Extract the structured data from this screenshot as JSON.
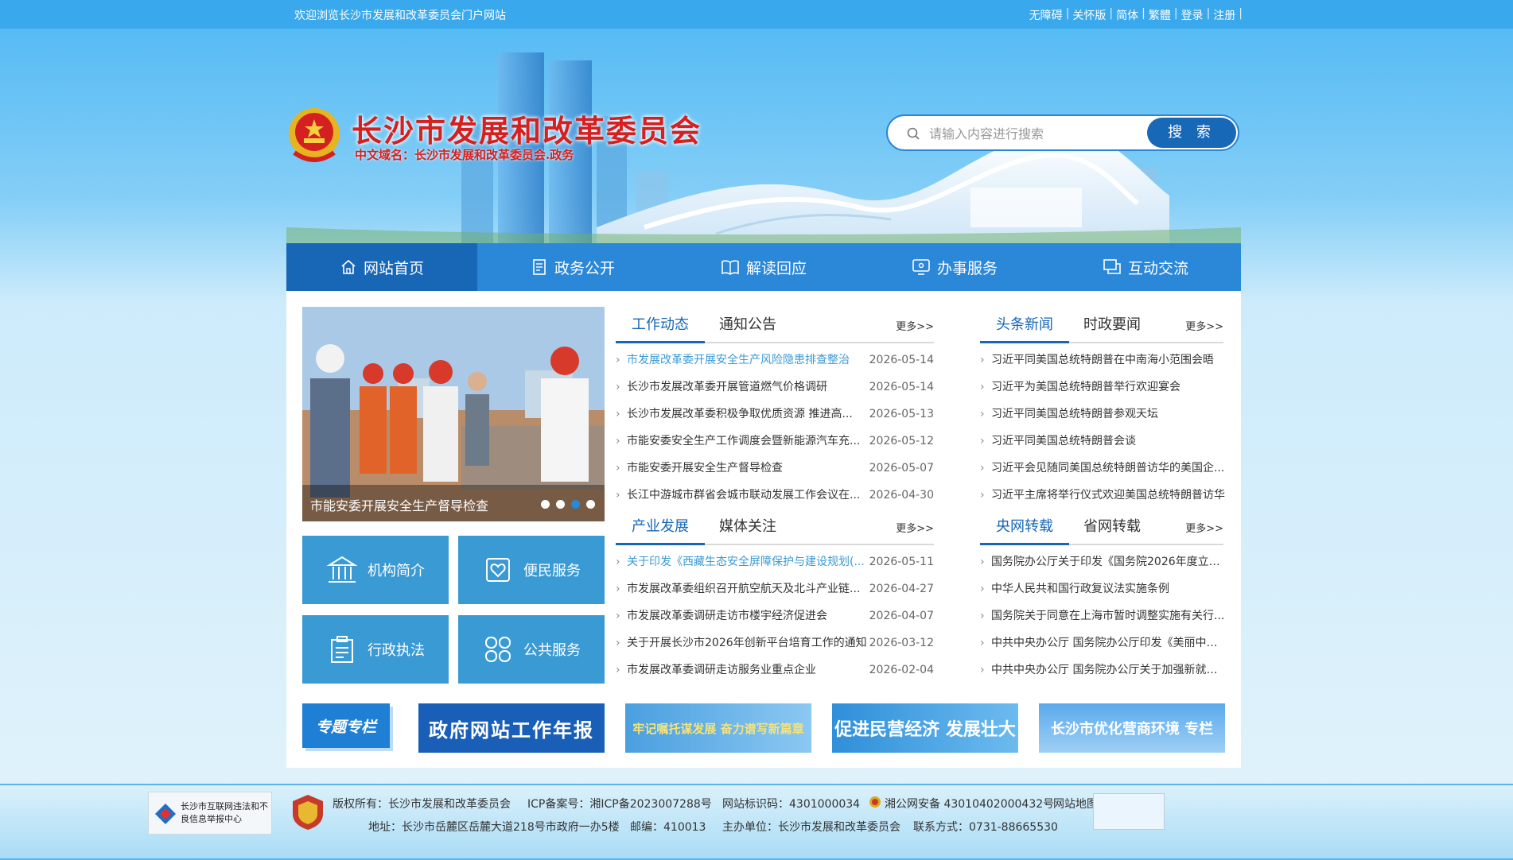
{
  "topbar": {
    "welcome": "欢迎浏览长沙市发展和改革委员会门户网站",
    "links": [
      "无障碍",
      "关怀版",
      "简体",
      "繁體",
      "登录",
      "注册"
    ]
  },
  "header": {
    "title": "长沙市发展和改革委员会",
    "subtitle": "中文域名：长沙市发展和改革委员会.政务"
  },
  "search": {
    "placeholder": "请输入内容进行搜索",
    "button": "搜 索"
  },
  "nav": {
    "items": [
      {
        "label": "网站首页",
        "icon": "home-icon"
      },
      {
        "label": "政务公开",
        "icon": "document-icon"
      },
      {
        "label": "解读回应",
        "icon": "book-icon"
      },
      {
        "label": "办事服务",
        "icon": "monitor-icon"
      },
      {
        "label": "互动交流",
        "icon": "chat-icon"
      }
    ]
  },
  "slider": {
    "caption": "市能安委开展安全生产督导检查",
    "dots": 4,
    "active_dot": 3
  },
  "tiles": [
    {
      "label": "机构简介",
      "icon": "institution-icon"
    },
    {
      "label": "便民服务",
      "icon": "heart-card-icon"
    },
    {
      "label": "行政执法",
      "icon": "clipboard-icon"
    },
    {
      "label": "公共服务",
      "icon": "grid-icon"
    }
  ],
  "more": "更多>>",
  "work": {
    "tabs": [
      "工作动态",
      "通知公告"
    ],
    "items": [
      {
        "title": "市发展改革委开展安全生产风险隐患排查整治",
        "date": "2026-05-14"
      },
      {
        "title": "长沙市发展改革委开展管道燃气价格调研",
        "date": "2026-05-14"
      },
      {
        "title": "长沙市发展改革委积极争取优质资源 推进高...",
        "date": "2026-05-13"
      },
      {
        "title": "市能安委安全生产工作调度会暨新能源汽车充...",
        "date": "2026-05-12"
      },
      {
        "title": "市能安委开展安全生产督导检查",
        "date": "2026-05-07"
      },
      {
        "title": "长江中游城市群省会城市联动发展工作会议在...",
        "date": "2026-04-30"
      }
    ]
  },
  "headline": {
    "tabs": [
      "头条新闻",
      "时政要闻"
    ],
    "items": [
      "习近平同美国总统特朗普在中南海小范围会晤",
      "习近平为美国总统特朗普举行欢迎宴会",
      "习近平同美国总统特朗普参观天坛",
      "习近平同美国总统特朗普会谈",
      "习近平会见随同美国总统特朗普访华的美国企...",
      "习近平主席将举行仪式欢迎美国总统特朗普访华"
    ]
  },
  "industry": {
    "tabs": [
      "产业发展",
      "媒体关注"
    ],
    "items": [
      {
        "title": "关于印发《西藏生态安全屏障保护与建设规划(...",
        "date": "2026-05-11"
      },
      {
        "title": "市发展改革委组织召开航空航天及北斗产业链...",
        "date": "2026-04-27"
      },
      {
        "title": "市发展改革委调研走访市楼宇经济促进会",
        "date": "2026-04-07"
      },
      {
        "title": "关于开展长沙市2026年创新平台培育工作的通知",
        "date": "2026-03-12"
      },
      {
        "title": "市发展改革委调研走访服务业重点企业",
        "date": "2026-02-04"
      }
    ]
  },
  "central": {
    "tabs": [
      "央网转载",
      "省网转载"
    ],
    "items": [
      "国务院办公厅关于印发《国务院2026年度立法...",
      "中华人民共和国行政复议法实施条例",
      "国务院关于同意在上海市暂时调整实施有关行...",
      "中共中央办公厅 国务院办公厅印发《美丽中国...",
      "中共中央办公厅 国务院办公厅关于加强新就业..."
    ]
  },
  "special": {
    "label": "专题专栏",
    "banners": [
      {
        "text": "政府网站工作年报"
      },
      {
        "text": "牢记嘱托谋发展 奋力谱写新篇章"
      },
      {
        "text": "促进民营经济 发展壮大"
      },
      {
        "text": "长沙市优化营商环境 专栏"
      }
    ]
  },
  "footer": {
    "badge": "长沙市互联网违法和不良信息举报中心",
    "copyright": "版权所有：长沙市发展和改革委员会",
    "icp": "ICP备案号：湘ICP备2023007288号",
    "site_id": "网站标识码：4301000034",
    "police": "湘公网安备 43010402000432号",
    "sitemap": "网站地图",
    "address": "地址：长沙市岳麓区岳麓大道218号市政府一办5楼",
    "postcode": "邮编：410013",
    "host": "主办单位：长沙市发展和改革委员会",
    "contact": "联系方式：0731-88665530"
  }
}
